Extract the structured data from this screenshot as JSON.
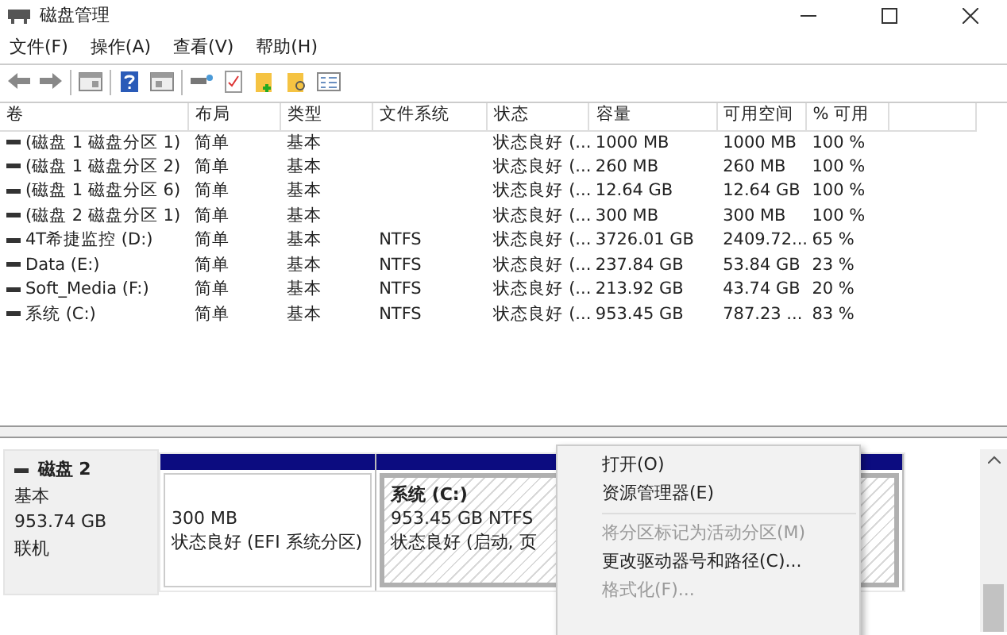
{
  "window": {
    "title": "磁盘管理"
  },
  "menu": [
    "文件(F)",
    "操作(A)",
    "查看(V)",
    "帮助(H)"
  ],
  "table": {
    "columns": [
      "卷",
      "布局",
      "类型",
      "文件系统",
      "状态",
      "容量",
      "可用空间",
      "% 可用"
    ],
    "rows": [
      {
        "cells": [
          "(磁盘 1 磁盘分区 1)",
          "简单",
          "基本",
          "",
          "状态良好 (...",
          "1000 MB",
          "1000 MB",
          "100 %"
        ]
      },
      {
        "cells": [
          "(磁盘 1 磁盘分区 2)",
          "简单",
          "基本",
          "",
          "状态良好 (...",
          "260 MB",
          "260 MB",
          "100 %"
        ]
      },
      {
        "cells": [
          "(磁盘 1 磁盘分区 6)",
          "简单",
          "基本",
          "",
          "状态良好 (...",
          "12.64 GB",
          "12.64 GB",
          "100 %"
        ]
      },
      {
        "cells": [
          "(磁盘 2 磁盘分区 1)",
          "简单",
          "基本",
          "",
          "状态良好 (...",
          "300 MB",
          "300 MB",
          "100 %"
        ]
      },
      {
        "cells": [
          "4T希捷监控 (D:)",
          "简单",
          "基本",
          "NTFS",
          "状态良好 (...",
          "3726.01 GB",
          "2409.72...",
          "65 %"
        ]
      },
      {
        "cells": [
          "Data (E:)",
          "简单",
          "基本",
          "NTFS",
          "状态良好 (...",
          "237.84 GB",
          "53.84 GB",
          "23 %"
        ]
      },
      {
        "cells": [
          "Soft_Media (F:)",
          "简单",
          "基本",
          "NTFS",
          "状态良好 (...",
          "213.92 GB",
          "43.74 GB",
          "20 %"
        ]
      },
      {
        "cells": [
          "系统 (C:)",
          "简单",
          "基本",
          "NTFS",
          "状态良好 (...",
          "953.45 GB",
          "787.23 ...",
          "83 %"
        ]
      }
    ]
  },
  "disk": {
    "name": "磁盘 2",
    "type": "基本",
    "size": "953.74 GB",
    "status": "联机",
    "partitions": [
      {
        "kind": "plain",
        "selected": false,
        "lines": [
          "300 MB",
          "状态良好 (EFI 系统分区)"
        ]
      },
      {
        "kind": "hatched",
        "selected": true,
        "title": "系统 (C:)",
        "lines": [
          "953.45 GB NTFS",
          "状态良好 (启动, 页"
        ]
      }
    ]
  },
  "context_menu": [
    {
      "kind": "item",
      "label": "打开(O)",
      "disabled": false
    },
    {
      "kind": "item",
      "label": "资源管理器(E)",
      "disabled": false
    },
    {
      "kind": "separator"
    },
    {
      "kind": "item",
      "label": "将分区标记为活动分区(M)",
      "disabled": true
    },
    {
      "kind": "item",
      "label": "更改驱动器号和路径(C)...",
      "disabled": false
    },
    {
      "kind": "item",
      "label": "格式化(F)...",
      "disabled": true
    }
  ]
}
